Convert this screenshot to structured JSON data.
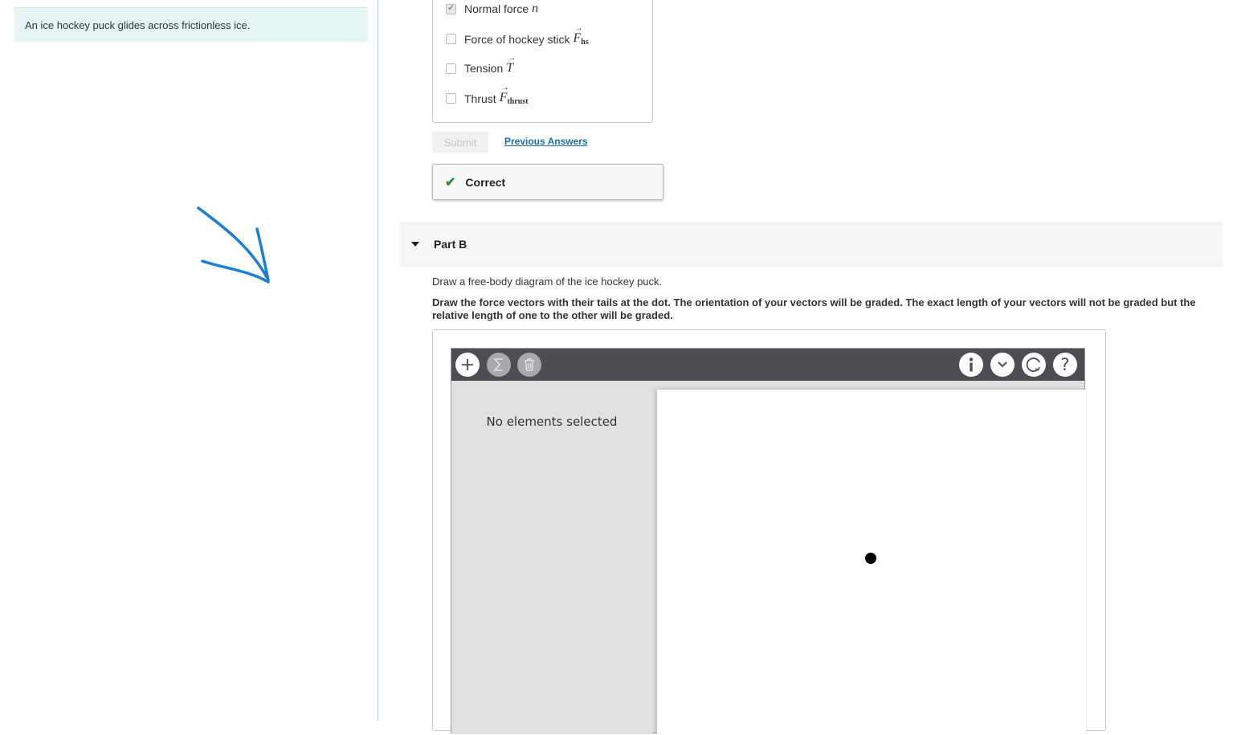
{
  "intro": {
    "text": "An ice hockey puck glides across frictionless ice."
  },
  "annotation": {
    "arrow_color": "#1a7fd4"
  },
  "part_a": {
    "choices": [
      {
        "label": "Normal force",
        "symbol": "n",
        "checked": true
      },
      {
        "label": "Force of hockey stick",
        "symbol": "F",
        "subscript": "hs",
        "checked": false
      },
      {
        "label": "Tension",
        "symbol": "T",
        "checked": false
      },
      {
        "label": "Thrust",
        "symbol": "F",
        "subscript": "thrust",
        "checked": false
      }
    ],
    "submit_label": "Submit",
    "previous_answers_label": "Previous Answers",
    "result_label": "Correct"
  },
  "part_b": {
    "title": "Part B",
    "instruction": "Draw a free-body diagram of the ice hockey puck.",
    "instruction_bold": "Draw the force vectors with their tails at the dot. The orientation of your vectors will be graded. The exact length of your vectors will not be graded but the relative length of one to the other will be graded.",
    "tool": {
      "side_panel_text": "No elements selected",
      "toolbar_left": [
        "add-icon",
        "sum-icon",
        "trash-icon"
      ],
      "toolbar_right": [
        "info-icon",
        "chevron-down-icon",
        "reset-icon",
        "help-icon"
      ]
    }
  },
  "colors": {
    "toolbar_bg": "#4d4e53",
    "intro_bg": "#e6f5f6",
    "link": "#1b6ea8",
    "check": "#2e8b3e"
  }
}
